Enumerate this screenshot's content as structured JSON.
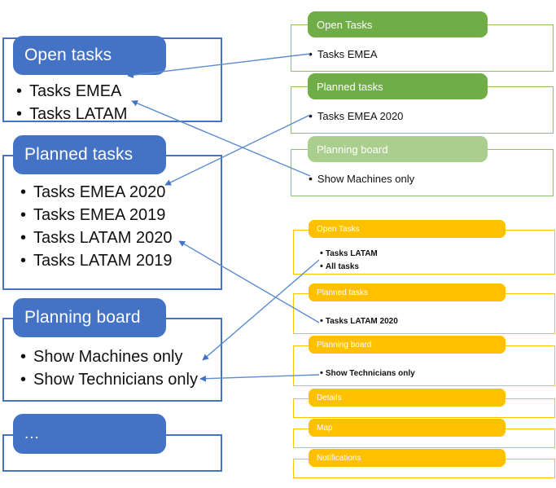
{
  "diagram": {
    "title": "Feature mapping diagram",
    "colors": {
      "blue": "#4472C4",
      "green": "#70AD47",
      "green_light": "#A9CE8E",
      "green_border": "#8CC267",
      "orange": "#FFC000",
      "arrow": "#5B8BD0",
      "text": "#111111"
    },
    "bullet_glyph": "•"
  },
  "left_column": {
    "cards": [
      {
        "id": "open-tasks",
        "header": "Open tasks",
        "items": [
          "Tasks EMEA",
          "Tasks LATAM"
        ]
      },
      {
        "id": "planned-tasks",
        "header": "Planned tasks",
        "items": [
          "Tasks EMEA 2020",
          "Tasks EMEA 2019",
          "Tasks LATAM 2020",
          "Tasks LATAM 2019"
        ]
      },
      {
        "id": "planning-board",
        "header": "Planning board",
        "items": [
          "Show Machines only",
          "Show Technicians only"
        ]
      },
      {
        "id": "more",
        "header": "...",
        "items": []
      }
    ]
  },
  "green_column": {
    "cards": [
      {
        "id": "green-open-tasks",
        "header": "Open Tasks",
        "items": [
          "Tasks EMEA"
        ]
      },
      {
        "id": "green-planned-tasks",
        "header": "Planned tasks",
        "items": [
          "Tasks EMEA 2020"
        ]
      },
      {
        "id": "green-planning-board",
        "header": "Planning board",
        "items": [
          "Show Machines only"
        ]
      }
    ]
  },
  "orange_column": {
    "cards": [
      {
        "id": "orange-open-tasks",
        "header": "Open Tasks",
        "items": [
          "Tasks LATAM",
          "All tasks"
        ]
      },
      {
        "id": "orange-planned-tasks",
        "header": "Planned tasks",
        "items": [
          "Tasks LATAM 2020"
        ]
      },
      {
        "id": "orange-planning-board",
        "header": "Planning board",
        "items": [
          "Show Technicians only"
        ]
      },
      {
        "id": "orange-details",
        "header": "Details",
        "items": []
      },
      {
        "id": "orange-map",
        "header": "Map",
        "items": []
      },
      {
        "id": "orange-notifications",
        "header": "Notifications",
        "items": []
      }
    ]
  },
  "connectors": [
    {
      "id": "c1",
      "from": "green-open-tasks-item-0",
      "to": "left-open-tasks-item-0"
    },
    {
      "id": "c2",
      "from": "green-planned-tasks-item-0",
      "to": "left-planned-tasks-item-0"
    },
    {
      "id": "c3",
      "from": "green-planning-board-item-0",
      "to": "left-planning-board-item-0"
    },
    {
      "id": "c4",
      "from": "orange-open-tasks-item-0",
      "to": "left-open-tasks-item-1"
    },
    {
      "id": "c5",
      "from": "orange-planned-tasks-item-0",
      "to": "left-planned-tasks-item-2"
    },
    {
      "id": "c6",
      "from": "orange-planning-board-item-0",
      "to": "left-planning-board-item-1"
    }
  ]
}
